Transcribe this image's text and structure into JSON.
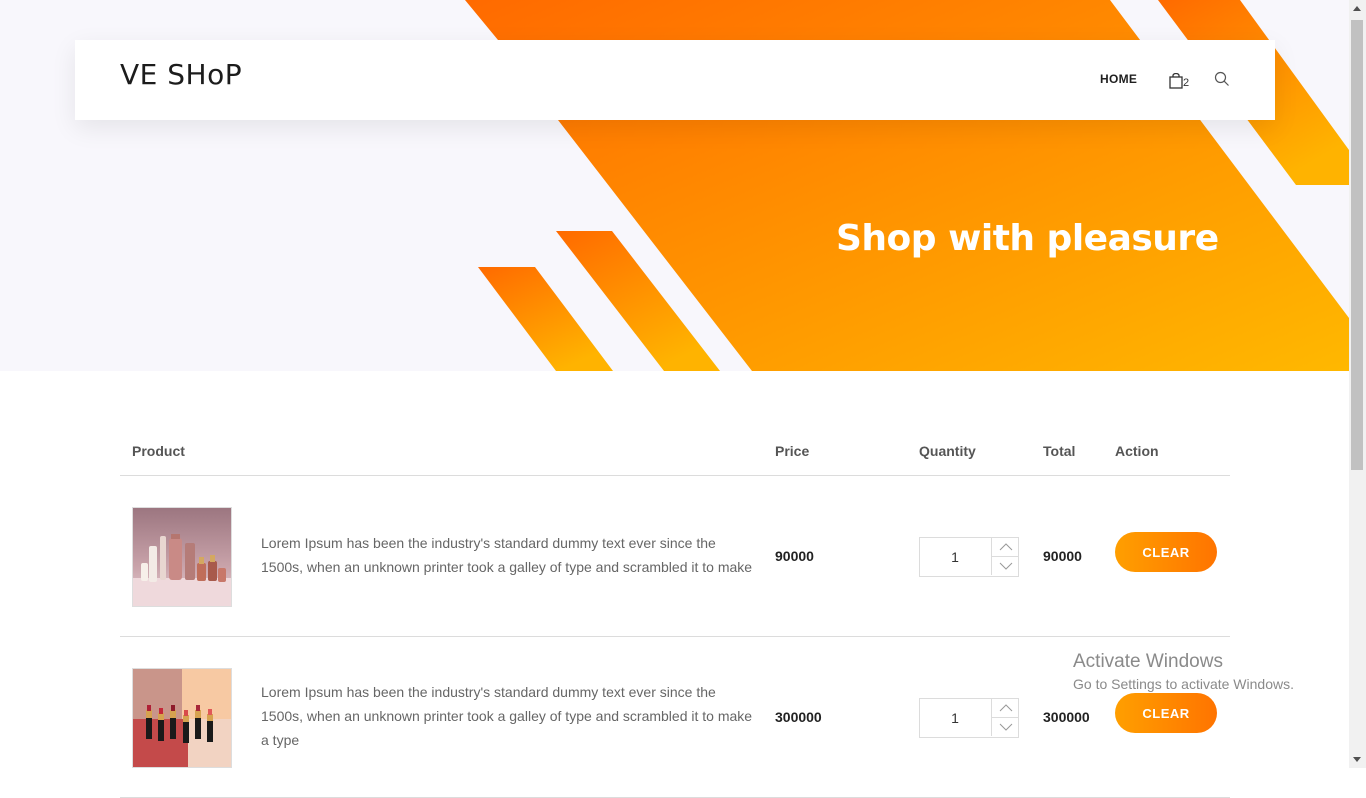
{
  "header": {
    "brand": "VE SHoP",
    "nav_home": "HOME",
    "cart_count": "2"
  },
  "hero": {
    "heading": "Shop with pleasure"
  },
  "table": {
    "headers": {
      "product": "Product",
      "price": "Price",
      "quantity": "Quantity",
      "total": "Total",
      "action": "Action"
    },
    "rows": [
      {
        "description": "Lorem Ipsum has been the industry's standard dummy text ever since the 1500s, when an unknown printer took a galley of type and scrambled it to make",
        "price": "90000",
        "quantity": "1",
        "total": "90000",
        "action_label": "CLEAR"
      },
      {
        "description": "Lorem Ipsum has been the industry's standard dummy text ever since the 1500s, when an unknown printer took a galley of type and scrambled it to make a type",
        "price": "300000",
        "quantity": "1",
        "total": "300000",
        "action_label": "CLEAR"
      }
    ]
  },
  "watermark": {
    "title": "Activate Windows",
    "subtitle": "Go to Settings to activate Windows."
  },
  "colors": {
    "accent_orange": "#ff7400",
    "accent_yellow": "#ffb300"
  }
}
